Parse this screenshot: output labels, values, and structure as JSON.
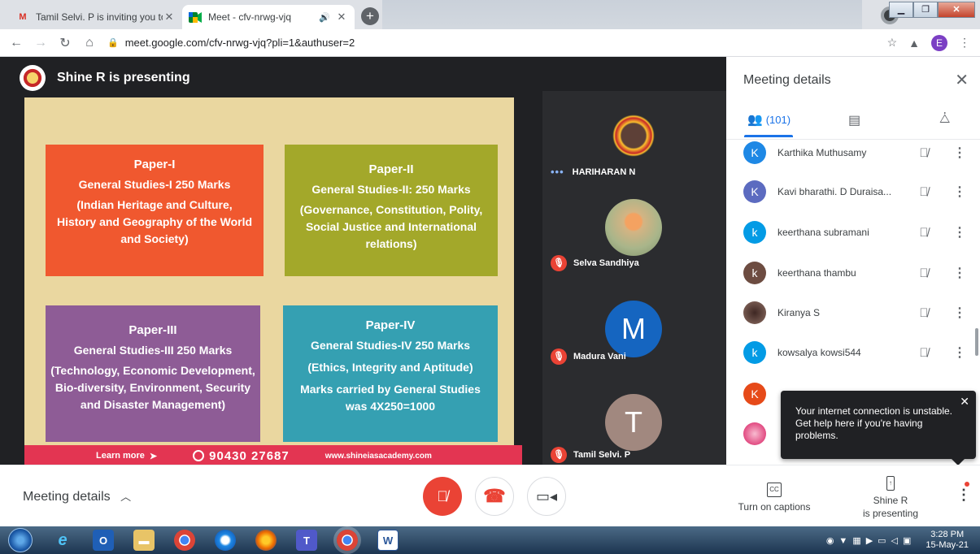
{
  "browser": {
    "tabs": [
      {
        "title": "Tamil Selvi. P is inviting you to a",
        "favicon": "gmail-icon",
        "active": false
      },
      {
        "title": "Meet - cfv-nrwg-vjq",
        "favicon": "meet-icon",
        "active": true
      }
    ],
    "url": "meet.google.com/cfv-nrwg-vjq?pli=1&authuser=2",
    "profile_initial": "E"
  },
  "presenting": {
    "banner": "Shine R is presenting"
  },
  "slide": {
    "boxes": [
      {
        "title": "Paper-I",
        "lines": [
          "General Studies-I 250 Marks",
          "(Indian Heritage and Culture,",
          "History and Geography of the World",
          "and Society)"
        ],
        "color": "#f0582f"
      },
      {
        "title": "Paper-II",
        "lines": [
          "General Studies-II: 250 Marks",
          "(Governance, Constitution, Polity,",
          "Social Justice and International",
          "relations)"
        ],
        "color": "#a3a82a"
      },
      {
        "title": "Paper-III",
        "lines": [
          "General Studies-III 250 Marks",
          "(Technology, Economic Development,",
          "Bio-diversity, Environment, Security",
          "and Disaster Management)"
        ],
        "color": "#8e5c96"
      },
      {
        "title": "Paper-IV",
        "lines": [
          "General Studies-IV 250 Marks",
          "(Ethics, Integrity and Aptitude)",
          "Marks carried by General Studies",
          "was 4X250=1000"
        ],
        "color": "#35a0b2"
      }
    ],
    "footer": {
      "learn_more": "Learn more",
      "phone": "90430 27687",
      "website": "www.shineiasacademy.com"
    }
  },
  "tiles": [
    {
      "name": "HARIHARAN N",
      "muted": false,
      "avatar_type": "photo"
    },
    {
      "name": "Selva Sandhiya",
      "muted": true,
      "avatar_type": "photo"
    },
    {
      "name": "Madura Vani",
      "muted": true,
      "avatar_type": "letter",
      "letter": "M",
      "color": "#1565c0"
    },
    {
      "name": "Tamil Selvi. P",
      "muted": true,
      "avatar_type": "letter",
      "letter": "T",
      "color": "#a1887f"
    }
  ],
  "panel": {
    "title": "Meeting details",
    "people_count": "(101)",
    "participants": [
      {
        "name": "Karthika Muthusamy",
        "initial": "K",
        "color": "#1e88e5"
      },
      {
        "name": "Kavi bharathi. D Duraisa...",
        "initial": "K",
        "color": "#5c6bc0"
      },
      {
        "name": "keerthana subramani",
        "initial": "k",
        "color": "#039be5"
      },
      {
        "name": "keerthana thambu",
        "initial": "k",
        "color": "#6d4c41"
      },
      {
        "name": "Kiranya S",
        "initial": "",
        "color": "#795548"
      },
      {
        "name": "kowsalya kowsi544",
        "initial": "k",
        "color": "#039be5"
      },
      {
        "name": "",
        "initial": "K",
        "color": "#e64a19"
      },
      {
        "name": "",
        "initial": "",
        "color": "#d81b60"
      }
    ]
  },
  "toast": {
    "message": "Your internet connection is unstable. Get help here if you're having problems."
  },
  "controls": {
    "meeting_details": "Meeting details",
    "captions": "Turn on captions",
    "captions_icon_text": "CC",
    "presenter_line1": "Shine R",
    "presenter_line2": "is presenting"
  },
  "taskbar": {
    "time": "3:28 PM",
    "date": "15-May-21"
  }
}
